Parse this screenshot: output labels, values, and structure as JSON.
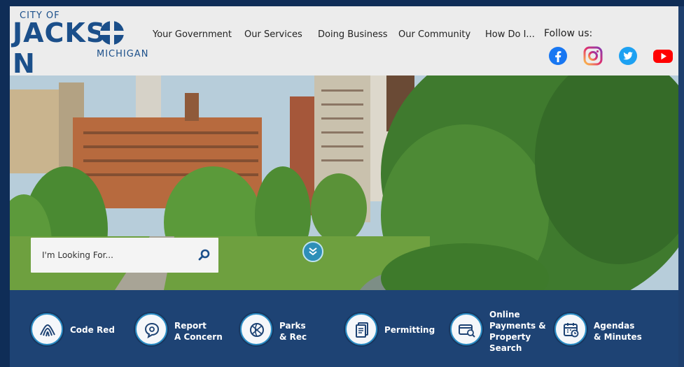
{
  "logo": {
    "city": "CITY OF",
    "name_part1": "JACKS",
    "name_part2": "N",
    "state": "MICHIGAN"
  },
  "nav": {
    "items": [
      {
        "label": "Your Government"
      },
      {
        "label": "Our Services"
      },
      {
        "label": "Doing Business"
      },
      {
        "label": "Our Community"
      },
      {
        "label": "How Do I..."
      }
    ]
  },
  "social": {
    "label": "Follow us:",
    "icons": [
      "facebook-icon",
      "instagram-icon",
      "twitter-icon",
      "youtube-icon"
    ]
  },
  "hero": {
    "search_placeholder": "I'm Looking For..."
  },
  "quick_links": [
    {
      "icon": "code-red-icon",
      "label_lines": [
        "Code Red"
      ]
    },
    {
      "icon": "report-concern-icon",
      "label_lines": [
        "Report",
        "A Concern"
      ]
    },
    {
      "icon": "parks-rec-icon",
      "label_lines": [
        "Parks",
        "& Rec"
      ]
    },
    {
      "icon": "permitting-icon",
      "label_lines": [
        "Permitting"
      ]
    },
    {
      "icon": "payments-icon",
      "label_lines": [
        "Online",
        "Payments &",
        "Property",
        "Search"
      ]
    },
    {
      "icon": "agendas-icon",
      "label_lines": [
        "Agendas",
        "& Minutes"
      ]
    }
  ],
  "colors": {
    "brand_blue": "#1b4f8a",
    "header_bg": "#ececec",
    "quick_links_bg": "#1e4374",
    "facebook": "#1877f2",
    "twitter": "#1da1f2",
    "youtube": "#ff0000"
  }
}
